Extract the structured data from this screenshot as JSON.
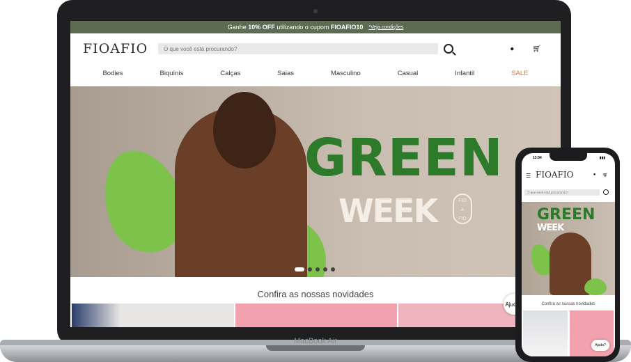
{
  "device": {
    "laptop_label": "MacBook Air"
  },
  "promo": {
    "text_pre": "Ganhe",
    "bold1": "10% OFF",
    "text_mid": "utilizando o cupom",
    "bold2": "FIOAFIO10",
    "link": "*Veja condições"
  },
  "header": {
    "logo": "FIOAFIO",
    "search_placeholder": "O que você está procurando?"
  },
  "nav": {
    "items": [
      "Bodies",
      "Biquínis",
      "Calças",
      "Saias",
      "Masculino",
      "Casual",
      "Infantil",
      "SALE"
    ]
  },
  "hero": {
    "title_line1": "GREEN",
    "title_line2": "WEEK",
    "badge_lines": [
      "FIO",
      "A",
      "FIO"
    ]
  },
  "section": {
    "novelties_title": "Confira as nossas novidades"
  },
  "help": {
    "label": "Ajuda?"
  },
  "phone": {
    "time": "13:54",
    "logo": "FIOAFIO",
    "search_placeholder": "O que você está procurando?",
    "title_line1": "GREEN",
    "title_line2": "WEEK",
    "novelties_title": "Confira as nossas novidades",
    "help_label": "Ajuda?"
  },
  "colors": {
    "promo_bar": "#5d6b52",
    "accent_green": "#2d7a2a",
    "leaf_green": "#7dc24a",
    "sale": "#e8733a"
  }
}
